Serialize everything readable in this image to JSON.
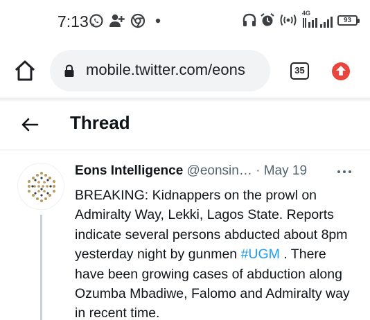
{
  "status_bar": {
    "time": "7:13",
    "network_label": "4G",
    "battery_level": "93"
  },
  "browser": {
    "url": "mobile.twitter.com/eons",
    "tab_count": "35",
    "update_color": "#e8453c"
  },
  "thread": {
    "title": "Thread"
  },
  "tweet": {
    "author_name": "Eons Intelligence",
    "author_handle": "@eonsin…",
    "separator": "·",
    "date": "May 19",
    "text_before": "BREAKING: Kidnappers on the prowl on Admiralty Way, Lekki, Lagos State. Reports indicate several persons abducted about 8pm yesterday night by gunmen ",
    "hashtag": "#UGM",
    "text_after": " . There have been growing cases of abduction along Ozumba Mbadiwe, Falomo and Admiralty way in recent time.",
    "link_color": "#1d9bf0"
  }
}
